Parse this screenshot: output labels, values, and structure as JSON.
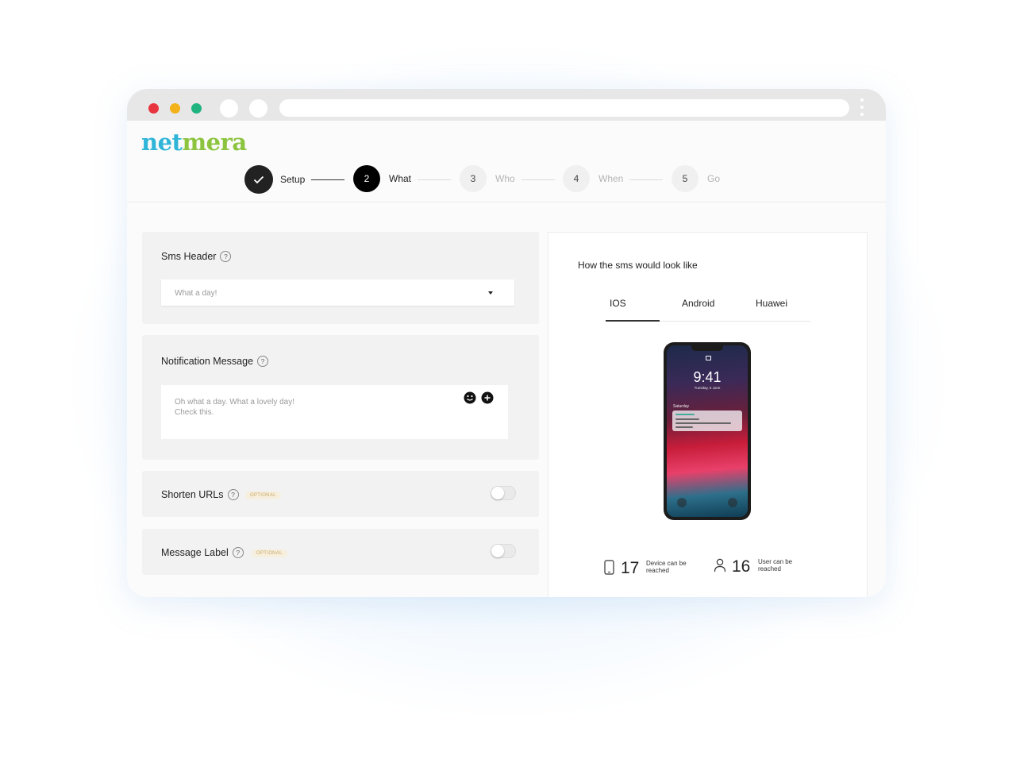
{
  "app": {
    "logo_part1": "net",
    "logo_part2": "mera",
    "brand_colors": {
      "logo_primary": "#2fb5d8",
      "logo_secondary": "#8cc43f"
    }
  },
  "window": {
    "traffic_lights": [
      "#e8343f",
      "#f4b21a",
      "#1fb380"
    ]
  },
  "stepper": {
    "steps": [
      {
        "label": "Setup",
        "number": "",
        "state": "done"
      },
      {
        "label": "What",
        "number": "2",
        "state": "active"
      },
      {
        "label": "Who",
        "number": "3",
        "state": "todo"
      },
      {
        "label": "When",
        "number": "4",
        "state": "todo"
      },
      {
        "label": "Go",
        "number": "5",
        "state": "todo"
      }
    ]
  },
  "form": {
    "sms_header": {
      "title": "Sms Header",
      "help": "?",
      "value": "What a day!"
    },
    "notification_message": {
      "title": "Notification Message",
      "help": "?",
      "line1": "Oh what a day. What a lovely day!",
      "line2": "Check this."
    },
    "shorten_urls": {
      "title": "Shorten URLs",
      "help": "?",
      "badge": "OPTIONAL",
      "enabled": false
    },
    "message_label": {
      "title": "Message Label",
      "help": "?",
      "badge": "OPTIONAL",
      "enabled": false
    }
  },
  "preview": {
    "title": "How the sms would look like",
    "tabs": [
      "IOS",
      "Android",
      "Huawei"
    ],
    "active_tab": "IOS",
    "phone": {
      "time": "9:41",
      "date": "Tuesday, 6 June",
      "day_label": "Saturday"
    },
    "stats": [
      {
        "icon": "phone-device-icon",
        "value": "17",
        "label": "Device can be reached"
      },
      {
        "icon": "user-icon",
        "value": "16",
        "label": "User can be reached"
      }
    ]
  }
}
